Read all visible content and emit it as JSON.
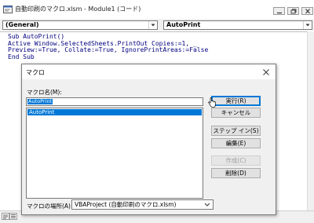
{
  "window": {
    "title": "自動印刷のマクロ.xlsm - Module1 (コード)",
    "object_combo": "(General)",
    "procedure_combo": "AutoPrint"
  },
  "code_lines": [
    "Sub AutoPrint()",
    "Active Window.SelectedSheets.PrintOut Copies:=1, _",
    "Preview:=True, Collate:=True, IgnorePrintAreas:=False",
    "End Sub"
  ],
  "dialog": {
    "title": "マクロ",
    "name_label": "マクロ名(M):",
    "name_value": "AutoPrint",
    "macros": [
      "AutoPrint"
    ],
    "location_label": "マクロの場所(A):",
    "location_value": "VBAProject (自動印刷のマクロ.xlsm)",
    "buttons": {
      "run": "実行(R)",
      "cancel": "キャンセル",
      "step_into": "ステップ イン(S)",
      "edit": "編集(E)",
      "create": "作成(C)",
      "delete": "削除(D)"
    }
  },
  "colors": {
    "selection": "#0078d7",
    "code_text": "#00007f",
    "dialog_bg": "#f0f0f0",
    "button_bg": "#e1e1e1"
  }
}
